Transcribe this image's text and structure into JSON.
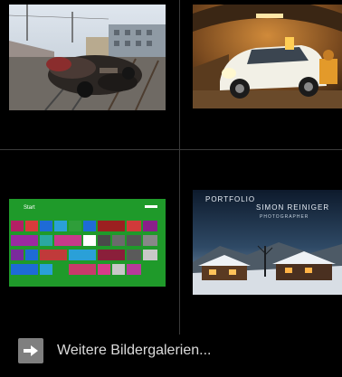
{
  "gallery": {
    "items": [
      {
        "alt": "Zerstörtes Autowrack auf Bahngleisen"
      },
      {
        "alt": "Weißer Kleinwagen nach Unfall im Tunnel"
      },
      {
        "alt": "Windows 8 Startbildschirm"
      },
      {
        "alt": "Portfolio Simon Reiniger"
      }
    ],
    "win8_start_label": "Start",
    "portfolio_line1": "PORTFOLIO",
    "portfolio_line2": "SIMON REINIGER",
    "portfolio_line3": "PHOTOGRAPHER"
  },
  "more_link": {
    "label": "Weitere Bildergalerien...",
    "icon": "arrow-right-icon"
  },
  "colors": {
    "background": "#000000",
    "divider": "#3a3a3a",
    "win8_green": "#1f9a2a",
    "icon_box": "#7f7f7f"
  }
}
